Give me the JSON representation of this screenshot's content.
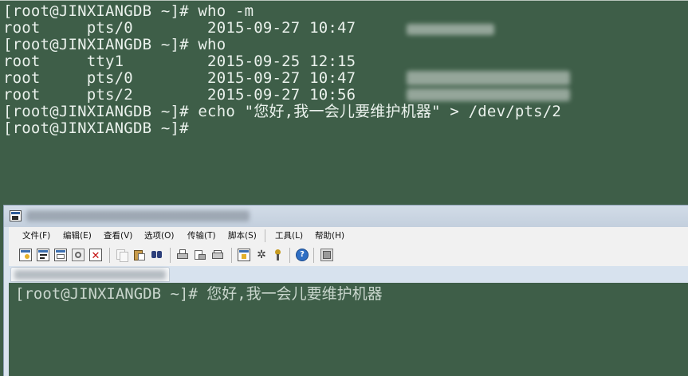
{
  "top_terminal": {
    "lines": [
      "[root@JINXIANGDB ~]# who -m",
      "root     pts/0        2015-09-27 10:47",
      "[root@JINXIANGDB ~]# who",
      "root     tty1         2015-09-25 12:15",
      "root     pts/0        2015-09-27 10:47",
      "root     pts/2        2015-09-27 10:56",
      "[root@JINXIANGDB ~]# echo \"您好,我一会儿要维护机器\" > /dev/pts/2",
      "[root@JINXIANGDB ~]#"
    ],
    "background": "#3e5e48",
    "foreground": "#eaf1ec"
  },
  "client_window": {
    "menu": [
      "文件(F)",
      "编辑(E)",
      "查看(V)",
      "选项(O)",
      "传输(T)",
      "脚本(S)",
      "工具(L)",
      "帮助(H)"
    ],
    "toolbar_icons": [
      "connect-icon",
      "quick-connect-icon",
      "connect-tab-icon",
      "reconnect-icon",
      "disconnect-icon",
      "copy-icon",
      "paste-icon",
      "find-icon",
      "print-icon",
      "print-setup-icon",
      "print-screen-icon",
      "session-options-icon",
      "global-options-icon",
      "key-icon",
      "help-icon",
      "sftp-icon"
    ],
    "terminal_line": "[root@JINXIANGDB ~]# 您好,我一会儿要维护机器"
  }
}
